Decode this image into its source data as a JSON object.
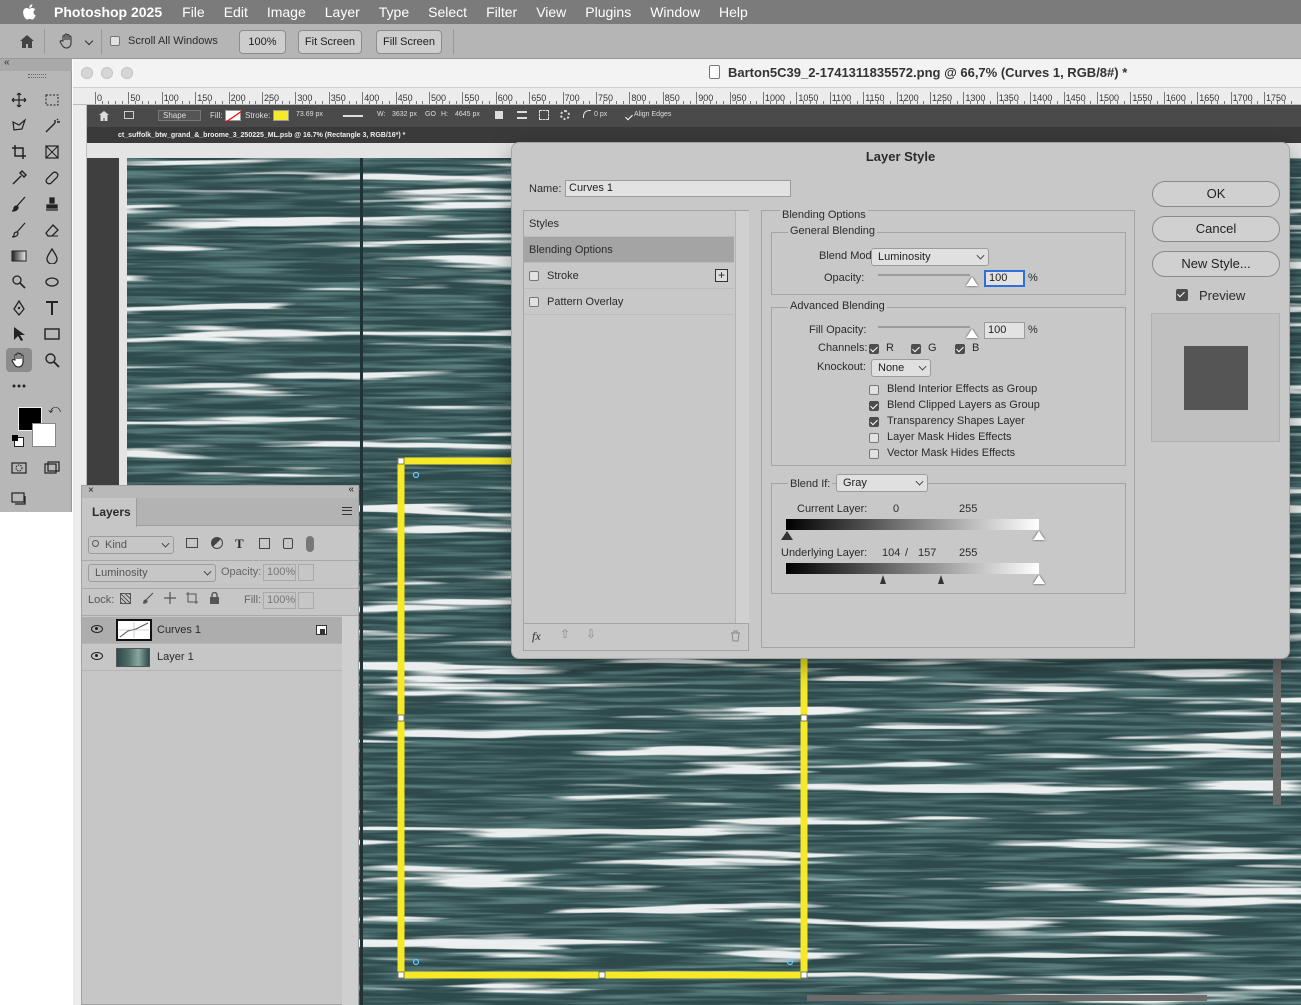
{
  "menubar": {
    "app_name": "Photoshop 2025",
    "items": [
      "File",
      "Edit",
      "Image",
      "Layer",
      "Type",
      "Select",
      "Filter",
      "View",
      "Plugins",
      "Window",
      "Help"
    ]
  },
  "optionsbar": {
    "scroll_all_label": "Scroll All Windows",
    "zoom_value": "100%",
    "fit_screen": "Fit Screen",
    "fill_screen": "Fill Screen"
  },
  "document": {
    "title": "Barton5C39_2-1741311835572.png @ 66,7% (Curves 1, RGB/8#) *",
    "ruler_labels": [
      "0",
      "50",
      "100",
      "150",
      "200",
      "250",
      "300",
      "350",
      "400",
      "450",
      "500",
      "550",
      "600",
      "650",
      "700",
      "750",
      "800",
      "850",
      "900",
      "950",
      "1000",
      "1050",
      "1100",
      "1150",
      "1200",
      "1250",
      "1300",
      "1350",
      "1400",
      "1450",
      "1500",
      "1550",
      "1600",
      "1650",
      "1700",
      "1750"
    ],
    "inner_optbar": {
      "shape_mode": "Shape",
      "fill_label": "Fill:",
      "stroke_label": "Stroke:",
      "stroke_width": "73.69 px",
      "w_label": "W:",
      "w_value": "3632 px",
      "go_label": "GO",
      "h_label": "H:",
      "h_value": "4645 px",
      "radius_value": "0 px",
      "align_edges": "Align Edges"
    },
    "inner_tab": "ct_suffolk_btw_grand_&_broome_3_250225_ML.psb @ 16.7% (Rectangle 3, RGB/16*) *"
  },
  "layers_panel": {
    "tab_label": "Layers",
    "filter_kind": "Kind",
    "blend_mode": "Luminosity",
    "opacity_label": "Opacity:",
    "opacity_value": "100%",
    "lock_label": "Lock:",
    "fill_label": "Fill:",
    "fill_value": "100%",
    "layers": [
      {
        "name": "Curves 1",
        "selected": true
      },
      {
        "name": "Layer 1",
        "selected": false
      }
    ]
  },
  "layer_style": {
    "title": "Layer Style",
    "name_label": "Name:",
    "name_value": "Curves 1",
    "styles_list": [
      {
        "label": "Styles",
        "checkbox": false,
        "active": false
      },
      {
        "label": "Blending Options",
        "checkbox": false,
        "active": true
      },
      {
        "label": "Stroke",
        "checkbox": true,
        "active": false
      },
      {
        "label": "Pattern Overlay",
        "checkbox": true,
        "active": false
      }
    ],
    "fx_label": "fx",
    "section_title": "Blending Options",
    "general_blending": "General Blending",
    "blend_mode_label": "Blend Mode:",
    "blend_mode_value": "Luminosity",
    "opacity_label": "Opacity:",
    "opacity_value": "100",
    "percent": "%",
    "advanced_blending": "Advanced Blending",
    "fill_opacity_label": "Fill Opacity:",
    "fill_opacity_value": "100",
    "channels_label": "Channels:",
    "channels": [
      "R",
      "G",
      "B"
    ],
    "knockout_label": "Knockout:",
    "knockout_value": "None",
    "options": [
      {
        "label": "Blend Interior Effects as Group",
        "checked": false
      },
      {
        "label": "Blend Clipped Layers as Group",
        "checked": true
      },
      {
        "label": "Transparency Shapes Layer",
        "checked": true
      },
      {
        "label": "Layer Mask Hides Effects",
        "checked": false
      },
      {
        "label": "Vector Mask Hides Effects",
        "checked": false
      }
    ],
    "blend_if_label": "Blend If:",
    "blend_if_value": "Gray",
    "current_layer_label": "Current Layer:",
    "current_layer_low": "0",
    "current_layer_high": "255",
    "underlying_layer_label": "Underlying Layer:",
    "underlying_low": "104",
    "underlying_sep": "/",
    "underlying_mid": "157",
    "underlying_high": "255",
    "ok": "OK",
    "cancel": "Cancel",
    "new_style": "New Style...",
    "preview_label": "Preview"
  },
  "colors": {
    "accent_yellow": "#f5e92a",
    "texture_teal": "#2e4a4c",
    "dialog_bg": "#c8c8c8"
  }
}
